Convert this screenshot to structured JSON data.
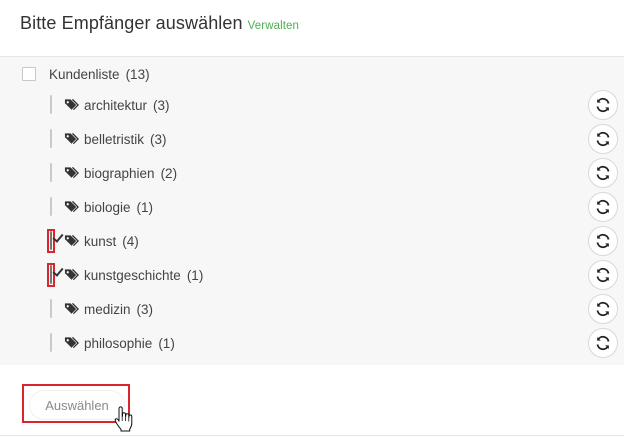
{
  "header": {
    "title": "Bitte Empfänger auswählen",
    "manage_link": "Verwalten"
  },
  "root": {
    "label": "Kundenliste",
    "count": "(13)",
    "checked": false
  },
  "items": [
    {
      "label": "architektur",
      "count": "(3)",
      "checked": false
    },
    {
      "label": "belletristik",
      "count": "(3)",
      "checked": false
    },
    {
      "label": "biographien",
      "count": "(2)",
      "checked": false
    },
    {
      "label": "biologie",
      "count": "(1)",
      "checked": false
    },
    {
      "label": "kunst",
      "count": "(4)",
      "checked": true
    },
    {
      "label": "kunstgeschichte",
      "count": "(1)",
      "checked": true
    },
    {
      "label": "medizin",
      "count": "(3)",
      "checked": false
    },
    {
      "label": "philosophie",
      "count": "(1)",
      "checked": false
    }
  ],
  "icons": {
    "item": "tags-icon",
    "action": "sync-icon"
  },
  "footer": {
    "select_button": "Auswählen"
  },
  "colors": {
    "accent_link": "#4caf50",
    "highlight": "#d9262e"
  }
}
